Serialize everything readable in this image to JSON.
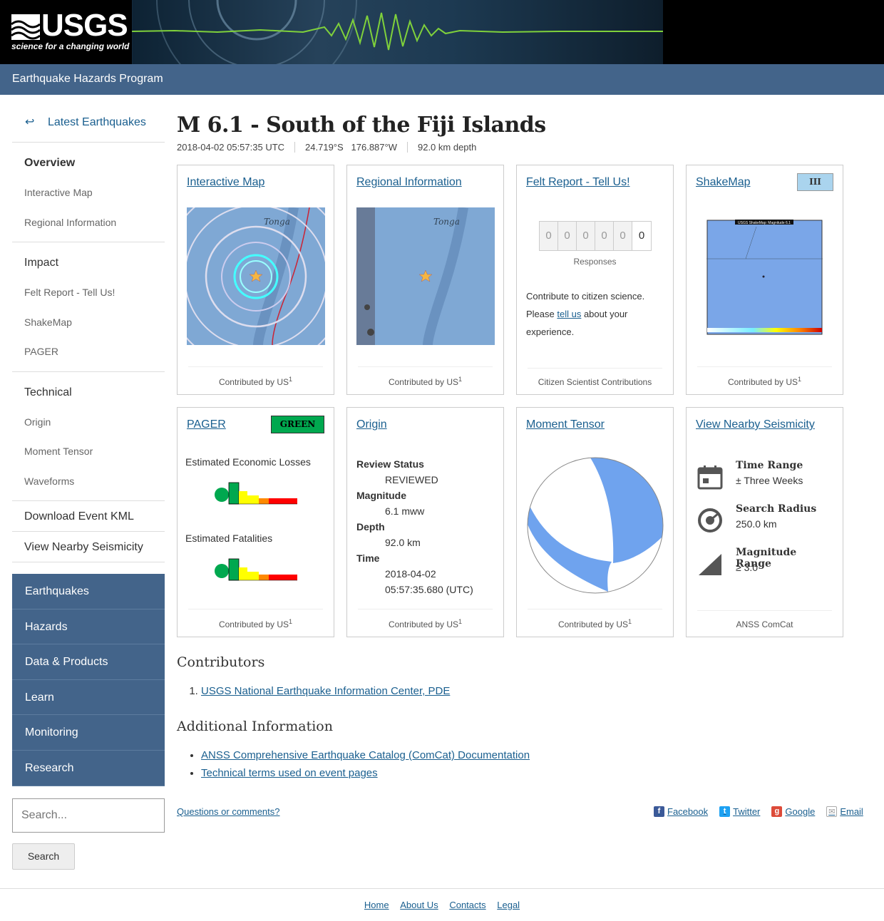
{
  "header": {
    "logo_word": "USGS",
    "logo_tagline": "science for a changing world",
    "program": "Earthquake Hazards Program"
  },
  "sidebar": {
    "back": "Latest Earthquakes",
    "overview": {
      "title": "Overview",
      "items": [
        "Interactive Map",
        "Regional Information"
      ]
    },
    "impact": {
      "title": "Impact",
      "items": [
        "Felt Report - Tell Us!",
        "ShakeMap",
        "PAGER"
      ]
    },
    "technical": {
      "title": "Technical",
      "items": [
        "Origin",
        "Moment Tensor",
        "Waveforms"
      ]
    },
    "kml": "Download Event KML",
    "nearby": "View Nearby Seismicity",
    "blue_nav": [
      "Earthquakes",
      "Hazards",
      "Data & Products",
      "Learn",
      "Monitoring",
      "Research"
    ],
    "search_placeholder": "Search...",
    "search_button": "Search"
  },
  "event": {
    "title": "M 6.1 - South of the Fiji Islands",
    "time": "2018-04-02 05:57:35 UTC",
    "coords": "24.719°S   176.887°W",
    "depth": "92.0 km depth"
  },
  "cards": {
    "map": {
      "title": "Interactive Map",
      "contrib": "Contributed by US",
      "sup": "1",
      "place": "Tonga"
    },
    "regional": {
      "title": "Regional Information",
      "contrib": "Contributed by US",
      "sup": "1",
      "place": "Tonga"
    },
    "felt": {
      "title": "Felt Report - Tell Us!",
      "digits": [
        "0",
        "0",
        "0",
        "0",
        "0",
        "0"
      ],
      "responses": "Responses",
      "text_a": "Contribute to citizen science. Please ",
      "link": "tell us",
      "text_b": " about your experience.",
      "contrib": "Citizen Scientist Contributions"
    },
    "shakemap": {
      "title": "ShakeMap",
      "badge": "III",
      "badge_color": "#aad4ee",
      "contrib": "Contributed by US",
      "sup": "1",
      "map_title": "USGS ShakeMap: Magnitude 6.1"
    },
    "pager": {
      "title": "PAGER",
      "badge": "GREEN",
      "badge_color": "#00a84f",
      "losses": "Estimated Economic Losses",
      "fatalities": "Estimated Fatalities",
      "contrib": "Contributed by US",
      "sup": "1"
    },
    "origin": {
      "title": "Origin",
      "review_label": "Review Status",
      "review": "REVIEWED",
      "mag_label": "Magnitude",
      "mag": "6.1 mww",
      "depth_label": "Depth",
      "depth": "92.0 km",
      "time_label": "Time",
      "date": "2018-04-02",
      "clock": "05:57:35.680 (UTC)",
      "contrib": "Contributed by US",
      "sup": "1"
    },
    "tensor": {
      "title": "Moment Tensor",
      "contrib": "Contributed by US",
      "sup": "1",
      "fill_color": "#6fa3ee"
    },
    "nearby": {
      "title": "View Nearby Seismicity",
      "time_label": "Time Range",
      "time": "± Three Weeks",
      "radius_label": "Search Radius",
      "radius": "250.0 km",
      "mag_label": "Magnitude Range",
      "mag": "≥ 3.0",
      "contrib": "ANSS ComCat"
    }
  },
  "contributors": {
    "heading": "Contributors",
    "items": [
      "USGS National Earthquake Information Center, PDE"
    ]
  },
  "additional": {
    "heading": "Additional Information",
    "items": [
      "ANSS Comprehensive Earthquake Catalog (ComCat) Documentation",
      "Technical terms used on event pages"
    ]
  },
  "footer": {
    "questions": "Questions or comments?",
    "share": [
      "Facebook",
      "Twitter",
      "Google",
      "Email"
    ],
    "links": [
      "Home",
      "About Us",
      "Contacts",
      "Legal"
    ]
  },
  "colors": {
    "nav_blue": "#43648a",
    "link": "#1a5f8f"
  }
}
